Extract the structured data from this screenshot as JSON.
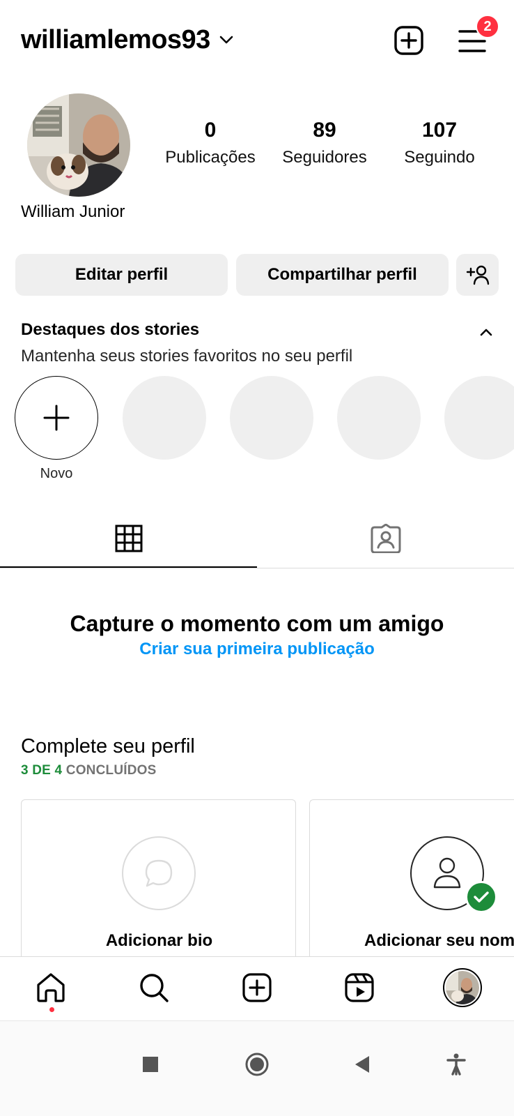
{
  "header": {
    "username": "williamlemos93",
    "notification_count": "2"
  },
  "profile": {
    "full_name": "William Junior",
    "stats": [
      {
        "value": "0",
        "label": "Publicações"
      },
      {
        "value": "89",
        "label": "Seguidores"
      },
      {
        "value": "107",
        "label": "Seguindo"
      }
    ]
  },
  "actions": {
    "edit_label": "Editar perfil",
    "share_label": "Compartilhar perfil"
  },
  "highlights": {
    "title": "Destaques dos stories",
    "subtitle": "Mantenha seus stories favoritos no seu perfil",
    "new_label": "Novo"
  },
  "tabs": {
    "icons": [
      "grid-icon",
      "tagged-icon"
    ],
    "active": 0
  },
  "empty_state": {
    "title": "Capture o momento com um amigo",
    "link": "Criar sua primeira publicação"
  },
  "complete_profile": {
    "title": "Complete seu perfil",
    "progress_done": "3 DE 4",
    "progress_suffix": "CONCLUÍDOS",
    "cards": [
      {
        "label": "Adicionar bio",
        "icon": "chat-bubble-icon"
      },
      {
        "label": "Adicionar seu nome",
        "icon": "person-check-icon"
      }
    ]
  },
  "bottom_nav": {
    "items": [
      "home-icon",
      "search-icon",
      "create-icon",
      "reels-icon",
      "profile-avatar"
    ]
  },
  "colors": {
    "link_blue": "#0095f6",
    "badge_red": "#ff3040",
    "success_green": "#1d8c3a",
    "button_gray": "#efefef"
  }
}
